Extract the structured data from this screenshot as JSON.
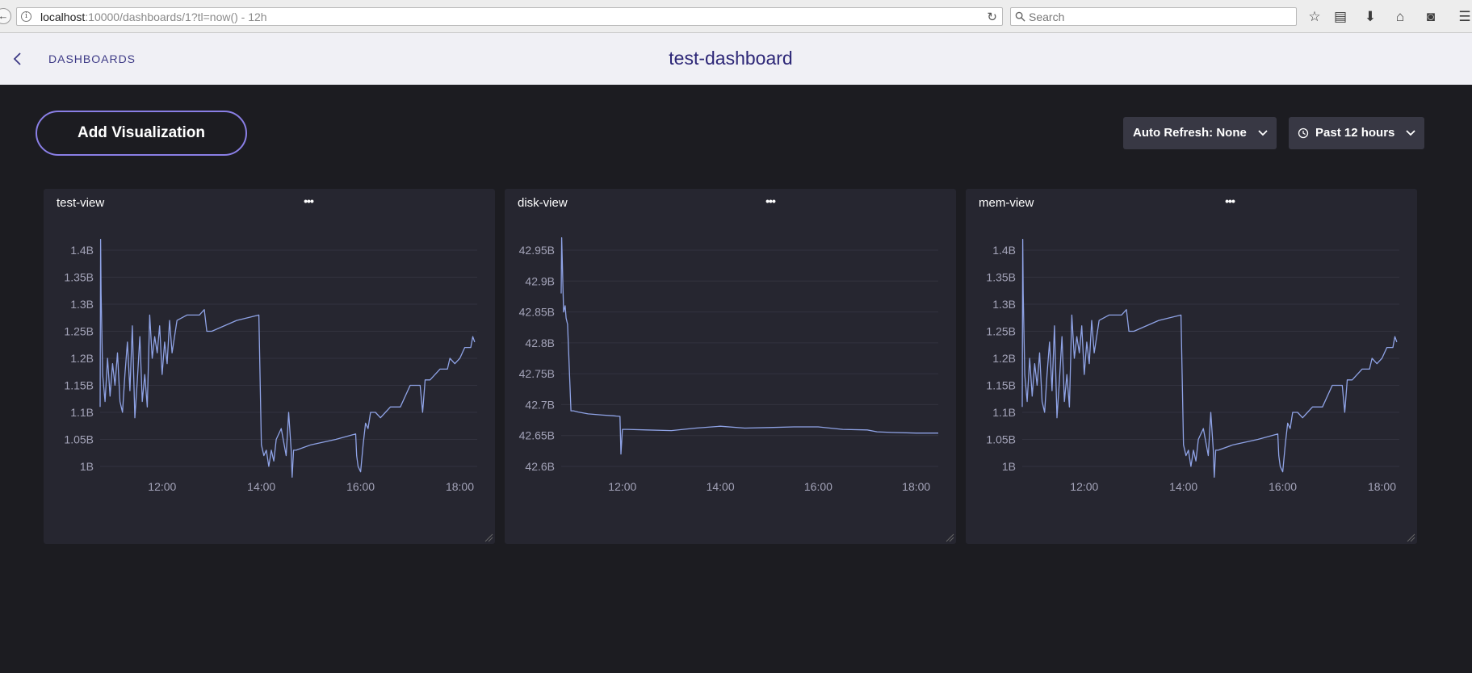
{
  "browser": {
    "url_host": "localhost",
    "url_rest": ":10000/dashboards/1?tl=now() - 12h",
    "search_placeholder": "Search"
  },
  "header": {
    "back_label": "DASHBOARDS",
    "title": "test-dashboard"
  },
  "controls": {
    "add_visualization": "Add Visualization",
    "auto_refresh": "Auto Refresh: None",
    "time_range": "Past 12 hours"
  },
  "colors": {
    "line": "#8fa3e6",
    "accent": "#8a7fe6",
    "panel": "#262630",
    "background": "#1c1c21"
  },
  "panels": [
    {
      "title": "test-view",
      "menu": "•••"
    },
    {
      "title": "disk-view",
      "menu": "•••"
    },
    {
      "title": "mem-view",
      "menu": "•••"
    }
  ],
  "chart_data": [
    {
      "type": "line",
      "title": "test-view",
      "x_ticks": [
        "12:00",
        "14:00",
        "16:00",
        "18:00"
      ],
      "y_ticks": [
        "1B",
        "1.05B",
        "1.1B",
        "1.15B",
        "1.2B",
        "1.25B",
        "1.3B",
        "1.35B",
        "1.4B"
      ],
      "ylim": [
        1.0,
        1.4
      ],
      "xlim": [
        10.75,
        18.35
      ],
      "series": [
        {
          "x": [
            10.75,
            10.76,
            10.77,
            10.8,
            10.85,
            10.9,
            10.95,
            11.0,
            11.05,
            11.1,
            11.15,
            11.2,
            11.25,
            11.3,
            11.35,
            11.4,
            11.45,
            11.5,
            11.55,
            11.6,
            11.65,
            11.7,
            11.75,
            11.8,
            11.85,
            11.9,
            11.95,
            12.0,
            12.05,
            12.1,
            12.15,
            12.2,
            12.3,
            12.5,
            12.75,
            12.85,
            12.9,
            13.0,
            13.5,
            13.95,
            14.0,
            14.05,
            14.1,
            14.15,
            14.2,
            14.25,
            14.3,
            14.4,
            14.5,
            14.55,
            14.6,
            14.62,
            14.65,
            14.7,
            15.0,
            15.5,
            15.9,
            15.92,
            15.95,
            16.0,
            16.05,
            16.1,
            16.15,
            16.2,
            16.3,
            16.4,
            16.5,
            16.6,
            16.8,
            17.0,
            17.2,
            17.25,
            17.3,
            17.4,
            17.6,
            17.75,
            17.8,
            17.9,
            18.0,
            18.1,
            18.2,
            18.22,
            18.26,
            18.3
          ],
          "y": [
            1.11,
            1.42,
            1.32,
            1.17,
            1.12,
            1.2,
            1.13,
            1.19,
            1.15,
            1.21,
            1.12,
            1.1,
            1.17,
            1.23,
            1.14,
            1.26,
            1.09,
            1.16,
            1.24,
            1.12,
            1.17,
            1.11,
            1.28,
            1.2,
            1.24,
            1.21,
            1.26,
            1.17,
            1.23,
            1.19,
            1.27,
            1.21,
            1.27,
            1.28,
            1.28,
            1.29,
            1.25,
            1.25,
            1.27,
            1.28,
            1.04,
            1.02,
            1.03,
            1.0,
            1.03,
            1.01,
            1.05,
            1.07,
            1.02,
            1.1,
            1.03,
            0.98,
            1.03,
            1.03,
            1.04,
            1.05,
            1.06,
            1.02,
            1.0,
            0.99,
            1.04,
            1.08,
            1.07,
            1.1,
            1.1,
            1.09,
            1.1,
            1.11,
            1.11,
            1.15,
            1.15,
            1.1,
            1.16,
            1.16,
            1.18,
            1.18,
            1.2,
            1.19,
            1.2,
            1.22,
            1.22,
            1.22,
            1.24,
            1.23
          ]
        }
      ]
    },
    {
      "type": "line",
      "title": "disk-view",
      "x_ticks": [
        "12:00",
        "14:00",
        "16:00",
        "18:00"
      ],
      "y_ticks": [
        "42.6B",
        "42.65B",
        "42.7B",
        "42.75B",
        "42.8B",
        "42.85B",
        "42.9B",
        "42.95B"
      ],
      "ylim": [
        42.6,
        42.95
      ],
      "xlim": [
        10.75,
        18.45
      ],
      "series": [
        {
          "x": [
            10.75,
            10.76,
            10.8,
            10.83,
            10.85,
            10.88,
            10.95,
            11.0,
            11.1,
            11.3,
            11.6,
            11.8,
            11.95,
            11.97,
            12.0,
            12.1,
            12.5,
            13.0,
            13.5,
            14.0,
            14.5,
            15.0,
            15.5,
            16.0,
            16.5,
            17.0,
            17.2,
            17.5,
            18.0,
            18.45
          ],
          "y": [
            42.88,
            42.97,
            42.85,
            42.86,
            42.84,
            42.83,
            42.69,
            42.69,
            42.688,
            42.685,
            42.683,
            42.682,
            42.681,
            42.62,
            42.66,
            42.66,
            42.659,
            42.658,
            42.662,
            42.665,
            42.662,
            42.663,
            42.664,
            42.664,
            42.66,
            42.659,
            42.656,
            42.655,
            42.654,
            42.654
          ]
        }
      ]
    },
    {
      "type": "line",
      "title": "mem-view",
      "x_ticks": [
        "12:00",
        "14:00",
        "16:00",
        "18:00"
      ],
      "y_ticks": [
        "1B",
        "1.05B",
        "1.1B",
        "1.15B",
        "1.2B",
        "1.25B",
        "1.3B",
        "1.35B",
        "1.4B"
      ],
      "ylim": [
        1.0,
        1.4
      ],
      "xlim": [
        10.75,
        18.35
      ],
      "series": [
        {
          "x": [
            10.75,
            10.76,
            10.77,
            10.8,
            10.85,
            10.9,
            10.95,
            11.0,
            11.05,
            11.1,
            11.15,
            11.2,
            11.25,
            11.3,
            11.35,
            11.4,
            11.45,
            11.5,
            11.55,
            11.6,
            11.65,
            11.7,
            11.75,
            11.8,
            11.85,
            11.9,
            11.95,
            12.0,
            12.05,
            12.1,
            12.15,
            12.2,
            12.3,
            12.5,
            12.75,
            12.85,
            12.9,
            13.0,
            13.5,
            13.95,
            14.0,
            14.05,
            14.1,
            14.15,
            14.2,
            14.25,
            14.3,
            14.4,
            14.5,
            14.55,
            14.6,
            14.62,
            14.65,
            14.7,
            15.0,
            15.5,
            15.9,
            15.92,
            15.95,
            16.0,
            16.05,
            16.1,
            16.15,
            16.2,
            16.3,
            16.4,
            16.5,
            16.6,
            16.8,
            17.0,
            17.2,
            17.25,
            17.3,
            17.4,
            17.6,
            17.75,
            17.8,
            17.9,
            18.0,
            18.1,
            18.2,
            18.22,
            18.26,
            18.3
          ],
          "y": [
            1.11,
            1.42,
            1.32,
            1.17,
            1.12,
            1.2,
            1.13,
            1.19,
            1.15,
            1.21,
            1.12,
            1.1,
            1.17,
            1.23,
            1.14,
            1.26,
            1.09,
            1.16,
            1.24,
            1.12,
            1.17,
            1.11,
            1.28,
            1.2,
            1.24,
            1.21,
            1.26,
            1.17,
            1.23,
            1.19,
            1.27,
            1.21,
            1.27,
            1.28,
            1.28,
            1.29,
            1.25,
            1.25,
            1.27,
            1.28,
            1.04,
            1.02,
            1.03,
            1.0,
            1.03,
            1.01,
            1.05,
            1.07,
            1.02,
            1.1,
            1.03,
            0.98,
            1.03,
            1.03,
            1.04,
            1.05,
            1.06,
            1.02,
            1.0,
            0.99,
            1.04,
            1.08,
            1.07,
            1.1,
            1.1,
            1.09,
            1.1,
            1.11,
            1.11,
            1.15,
            1.15,
            1.1,
            1.16,
            1.16,
            1.18,
            1.18,
            1.2,
            1.19,
            1.2,
            1.22,
            1.22,
            1.22,
            1.24,
            1.23
          ]
        }
      ]
    }
  ]
}
